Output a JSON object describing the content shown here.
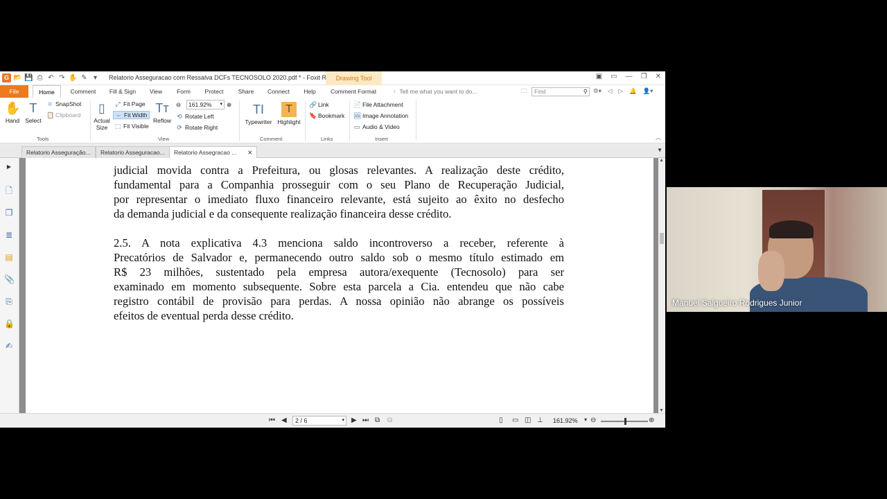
{
  "window": {
    "title": "Relatorio Asseguracao com Ressalva DCFs  TECNOSOLO 2020.pdf * - Foxit Re...",
    "context_tab": "Drawing Tool"
  },
  "menu_tabs": [
    "File",
    "Home",
    "Comment",
    "Fill & Sign",
    "View",
    "Form",
    "Protect",
    "Share",
    "Connect",
    "Help",
    "Comment Format"
  ],
  "tell_me_placeholder": "Tell me what you want to do...",
  "find_placeholder": "Find",
  "ribbon": {
    "tools": {
      "hand": "Hand",
      "select": "Select",
      "snapshot": "SnapShot",
      "clipboard": "Clipboard",
      "group": "Tools"
    },
    "view": {
      "actual_size": "Actual Size",
      "fit_page": "Fit Page",
      "fit_width": "Fit Width",
      "fit_visible": "Fit Visible",
      "reflow": "Reflow",
      "zoom": "161.92%",
      "rotate_left": "Rotate Left",
      "rotate_right": "Rotate Right",
      "group": "View"
    },
    "comment": {
      "typewriter": "Typewriter",
      "highlight": "Highlight",
      "group": "Comment"
    },
    "links": {
      "link": "Link",
      "bookmark": "Bookmark",
      "group": "Links"
    },
    "insert": {
      "file_attachment": "File Attachment",
      "image_annotation": "Image Annotation",
      "audio_video": "Audio & Video",
      "group": "Insert"
    }
  },
  "doc_tabs": [
    "Relatorio Asseguração...",
    "Relatorio Asseguracao...",
    "Relatorio Assegracao ..."
  ],
  "document": {
    "para1_lines": [
      "judicial movida contra a Prefeitura, ou glosas relevantes. A realização deste crédito,",
      "fundamental para a Companhia prosseguir com o seu Plano de Recuperação Judicial,",
      "por representar o imediato fluxo financeiro relevante, está sujeito ao êxito no desfecho"
    ],
    "para1_last": "da demanda judicial e da consequente realização financeira desse crédito.",
    "para2_lines": [
      "2.5. A nota explicativa 4.3 menciona saldo incontroverso a receber, referente à",
      "Precatórios de Salvador e, permanecendo outro saldo sob o mesmo título estimado em",
      "R$ 23 milhões, sustentado pela empresa autora/exequente (Tecnosolo) para ser",
      "examinado em momento subsequente. Sobre esta parcela a Cia. entendeu que não cabe",
      "registro contábil de provisão para perdas. A nossa opinião não abrange os possíveis"
    ],
    "para2_last": "efeitos de eventual perda desse crédito."
  },
  "status": {
    "page": "2 / 6",
    "zoom": "161.92%"
  },
  "participant": {
    "name": "Manuel Salgueiro Rodrigues Junior"
  },
  "colors": {
    "accent_orange": "#ec7a1e",
    "drawing_tool_bg": "#fde9c5",
    "select_blue": "#cfe3f7"
  }
}
